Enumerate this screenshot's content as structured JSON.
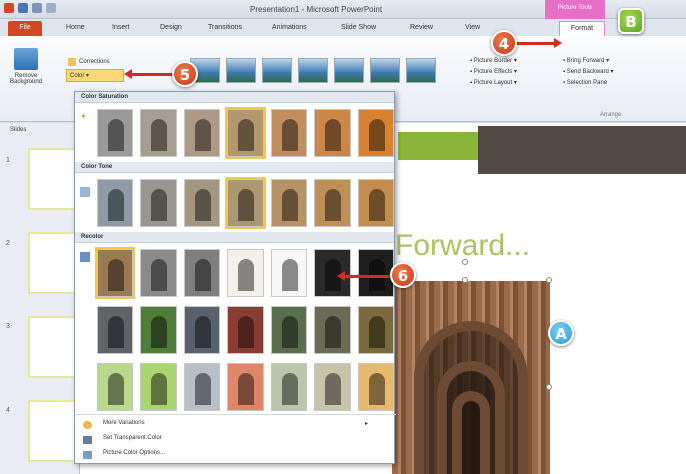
{
  "window": {
    "title": "Presentation1 - Microsoft PowerPoint",
    "contextual_tab_group": "Picture Tools"
  },
  "ribbon_tabs": {
    "file": "File",
    "items": [
      "Home",
      "Insert",
      "Design",
      "Transitions",
      "Animations",
      "Slide Show",
      "Review",
      "View"
    ],
    "format": "Format"
  },
  "ribbon": {
    "remove_background": "Remove Background",
    "corrections": "Corrections",
    "color": "Color",
    "picture_border": "Picture Border",
    "picture_effects": "Picture Effects",
    "picture_layout": "Picture Layout",
    "bring_forward": "Bring Forward",
    "send_backward": "Send Backward",
    "selection_pane": "Selection Pane",
    "arrange_label": "Arrange"
  },
  "left_pane": {
    "tab_slides": "Slides",
    "slide_numbers": [
      "1",
      "2",
      "3",
      "4"
    ]
  },
  "slide": {
    "title_text": "Forward..."
  },
  "color_menu": {
    "section_saturation": "Color Saturation",
    "section_tone": "Color Tone",
    "section_recolor": "Recolor",
    "more_variations": "More Variations",
    "set_transparent": "Set Transparent Color",
    "picture_color_options": "Picture Color Options..."
  },
  "callouts": {
    "step4": "4",
    "step5": "5",
    "step6": "6",
    "labelA": "A",
    "labelB": "B"
  },
  "colors": {
    "file_tab": "#d24726",
    "callout_red": "#d4401f",
    "callout_green": "#6cb82a",
    "callout_blue": "#2a9ad6",
    "selected_swatch_outline": "#f0c850",
    "slide_accent": "#a9c464"
  }
}
